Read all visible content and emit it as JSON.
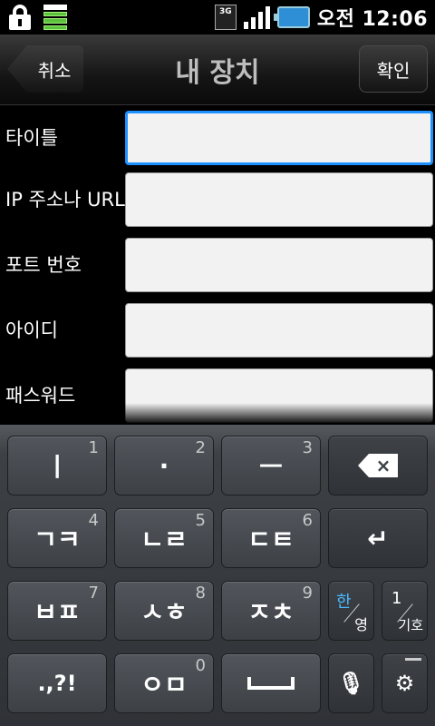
{
  "status_bar": {
    "network_type": "3G",
    "clock": "오전 12:06"
  },
  "title_bar": {
    "back_label": "취소",
    "title": "내 장치",
    "confirm_label": "확인"
  },
  "form": {
    "fields": [
      {
        "label": "타이틀",
        "value": "",
        "focused": true
      },
      {
        "label": "IP 주소나 URL",
        "value": ""
      },
      {
        "label": "포트 번호",
        "value": ""
      },
      {
        "label": "아이디",
        "value": ""
      },
      {
        "label": "패스워드",
        "value": ""
      }
    ]
  },
  "keyboard": {
    "keys": [
      {
        "label": "ㅣ",
        "num": "1"
      },
      {
        "label": "·",
        "num": "2"
      },
      {
        "label": "ㅡ",
        "num": "3"
      },
      {
        "label": "ㄱㅋ",
        "num": "4"
      },
      {
        "label": "ㄴㄹ",
        "num": "5"
      },
      {
        "label": "ㄷㅌ",
        "num": "6"
      },
      {
        "label": "ㅂㅍ",
        "num": "7"
      },
      {
        "label": "ㅅㅎ",
        "num": "8"
      },
      {
        "label": "ㅈㅊ",
        "num": "9"
      },
      {
        "label": ".,?!",
        "num": ""
      },
      {
        "label": "ㅇㅁ",
        "num": "0"
      }
    ],
    "enter_symbol": "↵",
    "lang_key": {
      "primary": "한",
      "secondary": "영"
    },
    "symbol_key": {
      "primary": "1",
      "secondary": "기호"
    },
    "mic_symbol": "🎙",
    "settings_symbol": "⚙"
  }
}
